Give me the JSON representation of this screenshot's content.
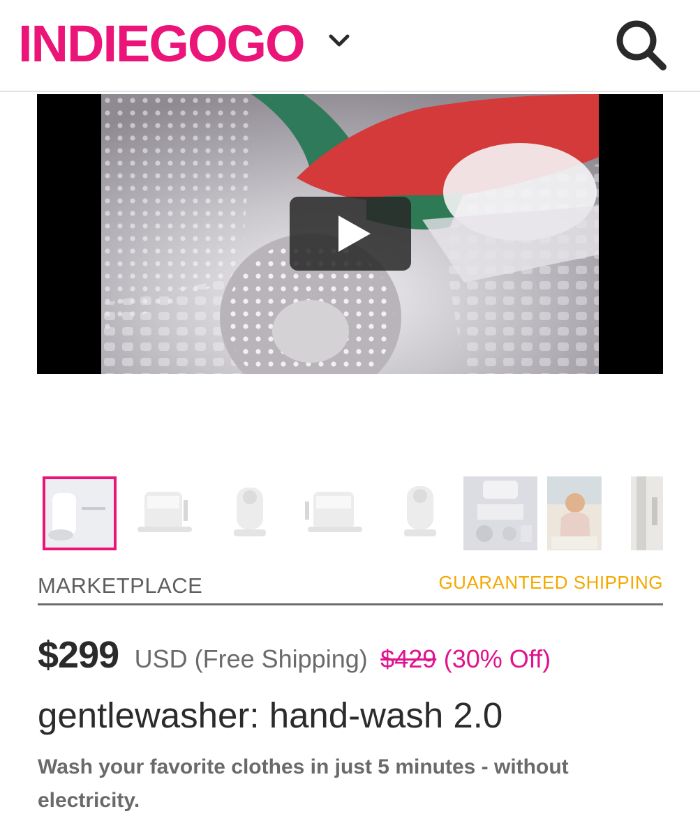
{
  "header": {
    "logo": "INDIEGOGO",
    "icons": {
      "dropdown": "chevron-down-icon",
      "search": "search-icon"
    },
    "brand_color": "#eb1478"
  },
  "video": {
    "play_icon": "play-icon"
  },
  "gallery": {
    "thumbnails": [
      {
        "label": "product thumbnail 1",
        "active": true
      },
      {
        "label": "product thumbnail 2",
        "active": false
      },
      {
        "label": "product thumbnail 3",
        "active": false
      },
      {
        "label": "product thumbnail 4",
        "active": false
      },
      {
        "label": "product thumbnail 5",
        "active": false
      },
      {
        "label": "product thumbnail 6",
        "active": false
      },
      {
        "label": "product thumbnail 7",
        "active": false
      },
      {
        "label": "product thumbnail 8",
        "active": false
      }
    ]
  },
  "labels": {
    "category": "MARKETPLACE",
    "shipping_badge": "GUARANTEED SHIPPING",
    "shipping_badge_color": "#f4a800"
  },
  "pricing": {
    "price": "$299",
    "currency_note": "USD (Free Shipping)",
    "original_price": "$429",
    "discount": "(30% Off)",
    "accent_color": "#e0138f"
  },
  "product": {
    "title": "gentlewasher: hand-wash 2.0",
    "description": "Wash your favorite clothes in just 5 minutes - without electricity."
  }
}
